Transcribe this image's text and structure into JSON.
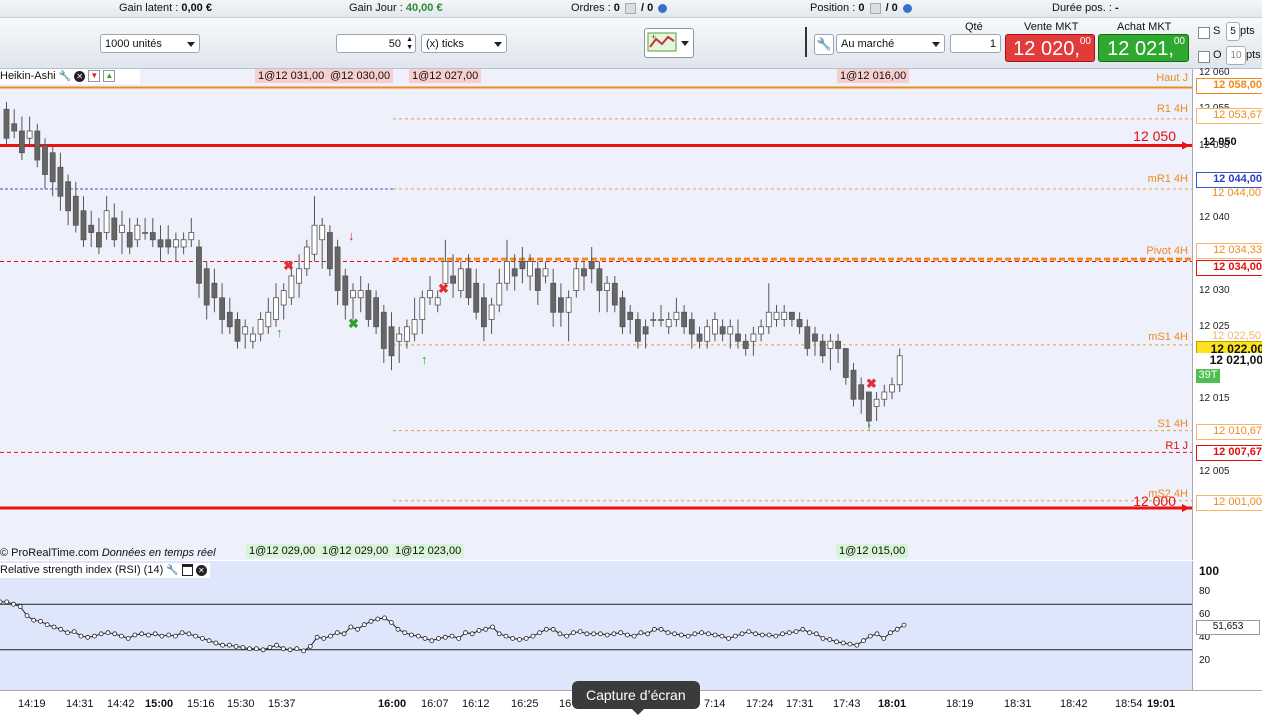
{
  "top_stats": {
    "gain_latent_label": "Gain latent :",
    "gain_latent_value": "0,00 €",
    "gain_jour_label": "Gain Jour :",
    "gain_jour_value": "40,00 €",
    "ordres_label": "Ordres :",
    "ordres_value": "0",
    "ordres_value2": "/ 0",
    "position_label": "Position :",
    "position_value": "0",
    "position_value2": "/ 0",
    "duree_label": "Durée pos. :",
    "duree_value": "-"
  },
  "toolbar": {
    "units_select": "1000 unités",
    "ticks_value": "50",
    "ticks_unit_select": "(x) ticks",
    "order_type_select": "Au marché",
    "qty_label": "Qté",
    "qty_value": "1",
    "sell_label": "Vente MKT",
    "sell_price": "12 020,",
    "sell_price_dec": "00",
    "buy_label": "Achat MKT",
    "buy_price": "12 021,",
    "buy_price_dec": "00",
    "stop_label": "S",
    "stop_value": "5",
    "stop_unit": "pts",
    "obj_label": "O",
    "obj_value": "10",
    "obj_unit": "pts"
  },
  "chart": {
    "indicator_name": "Heikin-Ashi",
    "top_orders": [
      "1@12 031,00",
      "@12 030,00",
      "1@12 027,00",
      "1@12 016,00"
    ],
    "bottom_orders": [
      "1@12 029,00",
      "1@12 029,00",
      "1@12 023,00",
      "1@12 015,00"
    ],
    "watermark": "© ProRealTime.com",
    "watermark_italic": "Données en temps réel",
    "line_label_12050": "12 050",
    "line_label_12000": "12 000",
    "level_labels": {
      "haut_j": "Haut J",
      "r1_4h": "R1 4H",
      "mr1_4h": "mR1 4H",
      "pivot_4h": "Pivot 4H",
      "ms1_4h": "mS1 4H",
      "s1_4h": "S1 4H",
      "r1_j": "R1 J",
      "ms2_4h": "mS2 4H"
    },
    "colors": {
      "red_line": "#ee1111",
      "orange_line": "#f08a1c",
      "candle_dark": "#666666",
      "candle_light": "#ffffff"
    }
  },
  "price_axis": {
    "ticks": [
      "12 060",
      "12 055",
      "12 050",
      "12 045",
      "12 040",
      "12 035",
      "12 030",
      "12 025",
      "12 020",
      "12 015",
      "12 010",
      "12 005",
      "12 000"
    ],
    "tags": {
      "haut_j": "12 058,00",
      "r1_4h": "12 053,67",
      "line_12050": "12 050",
      "blue": "12 044,00",
      "mr1": "12 044,00",
      "pivot": "12 034,33",
      "red": "12 034,00",
      "ms1": "12 022,50",
      "last_yellow": "12 022,00",
      "last_white": "12 021,00",
      "countdown": "39T",
      "s1": "12 010,67",
      "r1j": "12 007,67",
      "ms2": "12 001,00"
    }
  },
  "rsi": {
    "title": "Relative strength index (RSI) (14)",
    "ticks": [
      "100",
      "80",
      "60",
      "40",
      "20"
    ],
    "current_value": "51,653"
  },
  "time_axis": {
    "labels": [
      "14:19",
      "14:31",
      "14:42",
      "15:00",
      "15:16",
      "15:30",
      "15:37",
      "16:00",
      "16:07",
      "16:12",
      "16:25",
      "16",
      "7:14",
      "17:24",
      "17:31",
      "17:43",
      "18:01",
      "18:19",
      "18:31",
      "18:42",
      "18:54",
      "19:01"
    ]
  },
  "tooltip": "Capture d’écran",
  "chart_data": {
    "type": "candlestick",
    "series": [
      {
        "name": "Heikin-Ashi",
        "ohlc": [
          [
            12055,
            12056,
            12050,
            12051
          ],
          [
            12053,
            12055,
            12051,
            12052
          ],
          [
            12052,
            12054,
            12048,
            12049
          ],
          [
            12051,
            12054,
            12050,
            12052
          ],
          [
            12052,
            12053,
            12047,
            12048
          ],
          [
            12050,
            12051,
            12044,
            12046
          ],
          [
            12049,
            12050,
            12043,
            12045
          ],
          [
            12047,
            12049,
            12041,
            12043
          ],
          [
            12045,
            12046,
            12039,
            12041
          ],
          [
            12043,
            12045,
            12038,
            12039
          ],
          [
            12041,
            12043,
            12036,
            12037
          ],
          [
            12039,
            12041,
            12036,
            12038
          ],
          [
            12038,
            12040,
            12035,
            12036
          ],
          [
            12038,
            12043,
            12037,
            12041
          ],
          [
            12040,
            12042,
            12036,
            12037
          ],
          [
            12038,
            12041,
            12035,
            12039
          ],
          [
            12038,
            12040,
            12035,
            12036
          ],
          [
            12037,
            12040,
            12036,
            12039
          ],
          [
            12038,
            12040,
            12037,
            12038
          ],
          [
            12038,
            12040,
            12036,
            12037
          ],
          [
            12037,
            12039,
            12034,
            12036
          ],
          [
            12037,
            12039,
            12035,
            12036
          ],
          [
            12036,
            12038,
            12034,
            12037
          ],
          [
            12036,
            12038,
            12035,
            12037
          ],
          [
            12037,
            12040,
            12036,
            12038
          ],
          [
            12036,
            12037,
            12029,
            12031
          ],
          [
            12033,
            12034,
            12026,
            12028
          ],
          [
            12031,
            12033,
            12027,
            12029
          ],
          [
            12029,
            12031,
            12024,
            12026
          ],
          [
            12027,
            12029,
            12024,
            12025
          ],
          [
            12026,
            12027,
            12022,
            12023
          ],
          [
            12024,
            12026,
            12022,
            12025
          ],
          [
            12023,
            12025,
            12022,
            12024
          ],
          [
            12024,
            12027,
            12023,
            12026
          ],
          [
            12025,
            12029,
            12024,
            12027
          ],
          [
            12026,
            12031,
            12025,
            12029
          ],
          [
            12028,
            12031,
            12026,
            12030
          ],
          [
            12029,
            12034,
            12028,
            12032
          ],
          [
            12031,
            12035,
            12029,
            12033
          ],
          [
            12033,
            12037,
            12032,
            12036
          ],
          [
            12035,
            12043,
            12034,
            12039
          ],
          [
            12037,
            12040,
            12033,
            12039
          ],
          [
            12038,
            12039,
            12032,
            12033
          ],
          [
            12036,
            12037,
            12028,
            12030
          ],
          [
            12032,
            12033,
            12026,
            12028
          ],
          [
            12029,
            12031,
            12026,
            12030
          ],
          [
            12029,
            12032,
            12027,
            12030
          ],
          [
            12030,
            12031,
            12025,
            12026
          ],
          [
            12029,
            12030,
            12024,
            12025
          ],
          [
            12027,
            12028,
            12020,
            12022
          ],
          [
            12025,
            12027,
            12019,
            12021
          ],
          [
            12023,
            12025,
            12020,
            12024
          ],
          [
            12023,
            12026,
            12022,
            12025
          ],
          [
            12024,
            12029,
            12023,
            12026
          ],
          [
            12026,
            12030,
            12024,
            12029
          ],
          [
            12029,
            12032,
            12028,
            12030
          ],
          [
            12028,
            12030,
            12027,
            12029
          ],
          [
            12031,
            12037,
            12030,
            12034
          ],
          [
            12032,
            12035,
            12029,
            12031
          ],
          [
            12030,
            12034,
            12029,
            12033
          ],
          [
            12033,
            12035,
            12028,
            12029
          ],
          [
            12031,
            12033,
            12026,
            12027
          ],
          [
            12029,
            12031,
            12023,
            12025
          ],
          [
            12026,
            12029,
            12024,
            12028
          ],
          [
            12028,
            12033,
            12027,
            12031
          ],
          [
            12031,
            12037,
            12030,
            12034
          ],
          [
            12033,
            12035,
            12030,
            12032
          ],
          [
            12034,
            12036,
            12031,
            12033
          ],
          [
            12032,
            12035,
            12030,
            12034
          ],
          [
            12033,
            12034,
            12028,
            12030
          ],
          [
            12032,
            12034,
            12031,
            12033
          ],
          [
            12031,
            12033,
            12025,
            12027
          ],
          [
            12029,
            12031,
            12025,
            12027
          ],
          [
            12027,
            12030,
            12023,
            12029
          ],
          [
            12030,
            12034,
            12029,
            12033
          ],
          [
            12033,
            12034,
            12030,
            12032
          ],
          [
            12034,
            12036,
            12031,
            12033
          ],
          [
            12033,
            12034,
            12027,
            12030
          ],
          [
            12030,
            12032,
            12027,
            12031
          ],
          [
            12031,
            12032,
            12027,
            12028
          ],
          [
            12029,
            12030,
            12024,
            12025
          ],
          [
            12027,
            12028,
            12024,
            12026
          ],
          [
            12026,
            12027,
            12022,
            12023
          ],
          [
            12025,
            12026,
            12022,
            12024
          ],
          [
            12026,
            12027,
            12025,
            12026
          ],
          [
            12026,
            12028,
            12025,
            12026
          ],
          [
            12025,
            12027,
            12024,
            12026
          ],
          [
            12026,
            12029,
            12025,
            12027
          ],
          [
            12027,
            12028,
            12024,
            12025
          ],
          [
            12026,
            12027,
            12022,
            12024
          ],
          [
            12024,
            12025,
            12022,
            12023
          ],
          [
            12023,
            12026,
            12022,
            12025
          ],
          [
            12024,
            12027,
            12023,
            12026
          ],
          [
            12025,
            12026,
            12023,
            12024
          ],
          [
            12024,
            12026,
            12022,
            12025
          ],
          [
            12024,
            12026,
            12022,
            12023
          ],
          [
            12023,
            12024,
            12021,
            12022
          ],
          [
            12023,
            12025,
            12021,
            12024
          ],
          [
            12024,
            12026,
            12023,
            12025
          ],
          [
            12025,
            12031,
            12024,
            12027
          ],
          [
            12026,
            12028,
            12025,
            12027
          ],
          [
            12026,
            12028,
            12025,
            12027
          ],
          [
            12027,
            12027,
            12025,
            12026
          ],
          [
            12026,
            12027,
            12024,
            12025
          ],
          [
            12025,
            12026,
            12021,
            12022
          ],
          [
            12024,
            12025,
            12021,
            12023
          ],
          [
            12023,
            12024,
            12020,
            12021
          ],
          [
            12022,
            12024,
            12019,
            12023
          ],
          [
            12023,
            12024,
            12020,
            12022
          ],
          [
            12022,
            12022,
            12017,
            12018
          ],
          [
            12019,
            12020,
            12014,
            12015
          ],
          [
            12017,
            12018,
            12013,
            12015
          ],
          [
            12016,
            12016,
            12011,
            12012
          ],
          [
            12014,
            12016,
            12012,
            12015
          ],
          [
            12015,
            12017,
            12014,
            12016
          ],
          [
            12016,
            12018,
            12015,
            12017
          ],
          [
            12017,
            12022,
            12016,
            12021
          ]
        ]
      }
    ],
    "levels": {
      "Haut J": 12058.0,
      "R1 4H": 12053.67,
      "12 050": 12050,
      "mR1 4H": 12044.0,
      "Pivot 4H": 12034.33,
      "red_12034": 12034.0,
      "mS1 4H": 12022.5,
      "S1 4H": 12010.67,
      "R1 J": 12007.67,
      "mS2 4H": 12001.0,
      "12 000": 12000
    },
    "last_price": 12021.0,
    "ylim": [
      12000,
      12060
    ],
    "rsi": {
      "name": "RSI (14)",
      "ylim": [
        0,
        100
      ],
      "levels": [
        70,
        30
      ],
      "values": [
        72,
        72,
        70,
        68,
        60,
        56,
        55,
        52,
        50,
        48,
        45,
        46,
        42,
        41,
        42,
        44,
        45,
        44,
        42,
        40,
        43,
        44,
        43,
        44,
        42,
        43,
        42,
        45,
        44,
        42,
        40,
        38,
        36,
        34,
        34,
        33,
        32,
        31,
        31,
        30,
        32,
        34,
        31,
        30,
        31,
        29,
        33,
        41,
        40,
        42,
        45,
        44,
        50,
        48,
        52,
        55,
        57,
        58,
        54,
        48,
        45,
        43,
        42,
        40,
        38,
        40,
        41,
        42,
        40,
        45,
        44,
        47,
        48,
        50,
        44,
        42,
        40,
        39,
        40,
        42,
        45,
        48,
        48,
        44,
        42,
        45,
        46,
        44,
        44,
        44,
        43,
        44,
        45,
        43,
        42,
        45,
        44,
        48,
        48,
        45,
        44,
        43,
        42,
        44,
        45,
        44,
        43,
        42,
        40,
        42,
        44,
        46,
        44,
        43,
        43,
        42,
        44,
        45,
        46,
        48,
        45,
        44,
        40,
        39,
        37,
        36,
        35,
        34,
        38,
        42,
        44,
        40,
        45,
        48,
        51.653
      ]
    }
  }
}
